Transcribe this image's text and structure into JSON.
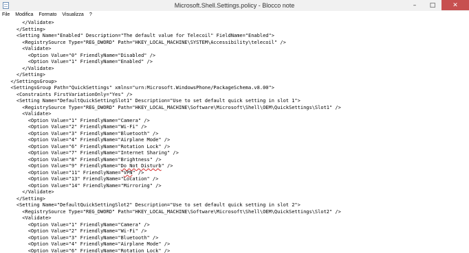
{
  "window": {
    "title": "Microsoft.Shell.Settings.policy - Blocco note",
    "minimize_glyph": "–",
    "maximize_glyph": "□",
    "close_glyph": "✕"
  },
  "menu": [
    "File",
    "Modifica",
    "Formato",
    "Visualizza",
    "?"
  ],
  "editor": {
    "lines": [
      "      </Validate>",
      "    </Setting>",
      "    <Setting Name=\"Enabled\" Description=\"The default value for Telecoil\" FieldName=\"Enabled\">",
      "      <RegistrySource Type=\"REG_DWORD\" Path=\"HKEY_LOCAL_MACHINE\\SYSTEM\\Accessibility\\telecoil\" />",
      "      <Validate>",
      "        <Option Value=\"0\" FriendlyName=\"Disabled\" />",
      "        <Option Value=\"1\" FriendlyName=\"Enabled\" />",
      "      </Validate>",
      "    </Setting>",
      "  </SettingsGroup>",
      "  <SettingsGroup Path=\"QuickSettings\" xmlns=\"urn:Microsoft.WindowsPhone/PackageSchema.v8.00\">",
      "    <Constraints FirstVariationOnly=\"Yes\" />",
      "    <Setting Name=\"DefaultQuickSettingSlot1\" Description=\"Use to set default quick setting in slot 1\">",
      "      <RegistrySource Type=\"REG_DWORD\" Path=\"HKEY_LOCAL_MACHINE\\Software\\Microsoft\\Shell\\OEM\\QuickSettings\\Slot1\" />",
      "      <Validate>",
      "        <Option Value=\"1\" FriendlyName=\"Camera\" />",
      "        <Option Value=\"2\" FriendlyName=\"Wi-Fi\" />",
      "        <Option Value=\"3\" FriendlyName=\"Bluetooth\" />",
      "        <Option Value=\"4\" FriendlyName=\"Airplane Mode\" />",
      "        <Option Value=\"6\" FriendlyName=\"Rotation Lock\" />",
      "        <Option Value=\"7\" FriendlyName=\"Internet Sharing\" />",
      "        <Option Value=\"8\" FriendlyName=\"Brightness\" />",
      "        <Option Value=\"9\" FriendlyName=\"Do Not Disturb\" />",
      "        <Option Value=\"11\" FriendlyName=\"VPN\" />",
      "        <Option Value=\"13\" FriendlyName=\"Location\" />",
      "        <Option Value=\"14\" FriendlyName=\"Mirroring\" />",
      "      </Validate>",
      "    </Setting>",
      "    <Setting Name=\"DefaultQuickSettingSlot2\" Description=\"Use to set default quick setting in slot 2\">",
      "      <RegistrySource Type=\"REG_DWORD\" Path=\"HKEY_LOCAL_MACHINE\\Software\\Microsoft\\Shell\\OEM\\QuickSettings\\Slot2\" />",
      "      <Validate>",
      "        <Option Value=\"1\" FriendlyName=\"Camera\" />",
      "        <Option Value=\"2\" FriendlyName=\"Wi-Fi\" />",
      "        <Option Value=\"3\" FriendlyName=\"Bluetooth\" />",
      "        <Option Value=\"4\" FriendlyName=\"Airplane Mode\" />",
      "        <Option Value=\"6\" FriendlyName=\"Rotation Lock\" />"
    ],
    "spellcheck_underlined": [
      "Do Not Disturb",
      "VPN"
    ]
  }
}
